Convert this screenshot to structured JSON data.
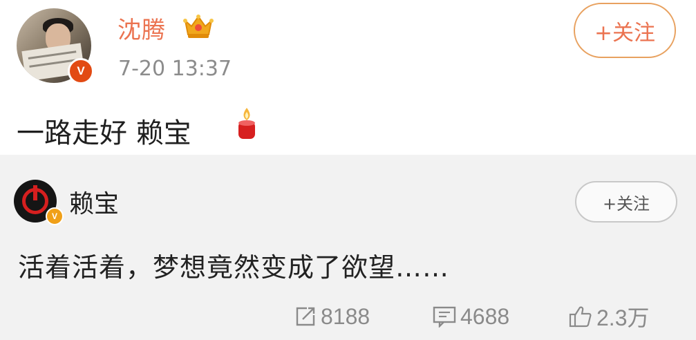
{
  "post": {
    "username": "沈腾",
    "timestamp": "7-20 13:37",
    "text": "一路走好 赖宝",
    "follow_label": "+关注"
  },
  "repost": {
    "username": "赖宝",
    "text": "活着活着，梦想竟然变成了欲望……",
    "follow_label": "+关注",
    "verified_mark": "V"
  },
  "actions": {
    "reposts": "8188",
    "comments": "4688",
    "likes": "2.3万"
  },
  "icons": {
    "crown": "crown-icon",
    "candle": "candle-icon",
    "share": "share-icon",
    "comment": "comment-icon",
    "like": "thumbs-up-icon"
  },
  "colors": {
    "username": "#eb7350",
    "verified_main": "#e24a13",
    "verified_small": "#f0a018",
    "muted_text": "#8c8c8c",
    "repost_bg": "#f2f2f2"
  }
}
